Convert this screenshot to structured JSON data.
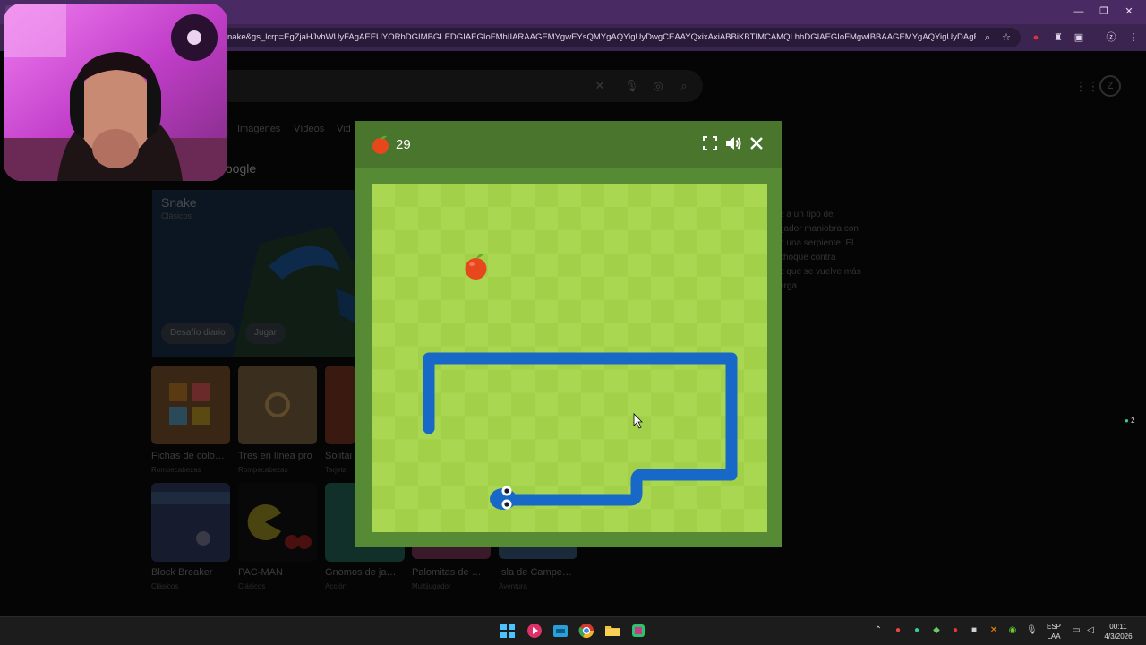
{
  "browser": {
    "url": "nake&gs_lcrp=EgZjaHJvbWUyFAgAEEUYORhDGIMBGLEDGIAEGIoFMhIIARAAGEMYgwEYsQMYgAQYigUyDwgCEAAYQxixAxiABBiKBTIMCAMQLhhDGIAEGIoFMgwIBBAAGEMYgAQYigUyDAgFEAAYQxiABBiK..."
  },
  "page": {
    "tabs": [
      "Imágenes",
      "Vídeos",
      "Vid"
    ],
    "google_label": "Google",
    "featured": {
      "title": "Snake",
      "subtitle": "Clásicos",
      "daily_button": "Desafío diario",
      "play_button": "Jugar"
    },
    "games": [
      {
        "title": "Fichas de colo…",
        "category": "Rompecabezas"
      },
      {
        "title": "Tres en línea pro",
        "category": "Rompecabezas"
      },
      {
        "title": "Solitai",
        "category": "Tarjeta"
      },
      {
        "title": "Block Breaker",
        "category": "Clásicos"
      },
      {
        "title": "PAC-MAN",
        "category": "Clásicos"
      },
      {
        "title": "Gnomos de ja…",
        "category": "Acción"
      },
      {
        "title": "Palomitas de …",
        "category": "Multijugador"
      },
      {
        "title": "Isla de Campe…",
        "category": "Aventura"
      }
    ],
    "description": [
      "e a un tipo de",
      "gador maniobra con",
      "n una serpiente. El",
      "choque contra",
      "o que se vuelve más",
      "arga."
    ]
  },
  "game": {
    "score": "29",
    "colors": {
      "board_light": "#aad751",
      "board_dark": "#a2d149",
      "frame": "#578a34",
      "header": "#4a752c",
      "snake": "#1868c8",
      "apple": "#e7471d"
    },
    "icons": {
      "score": "apple-icon",
      "fullscreen": "fullscreen-icon",
      "sound": "volume-icon",
      "close": "close-icon"
    }
  },
  "taskbar": {
    "language": "ESP",
    "language_sub": "LAA",
    "time": "00:11",
    "date": "4/3/2026",
    "notification_count": "2"
  }
}
